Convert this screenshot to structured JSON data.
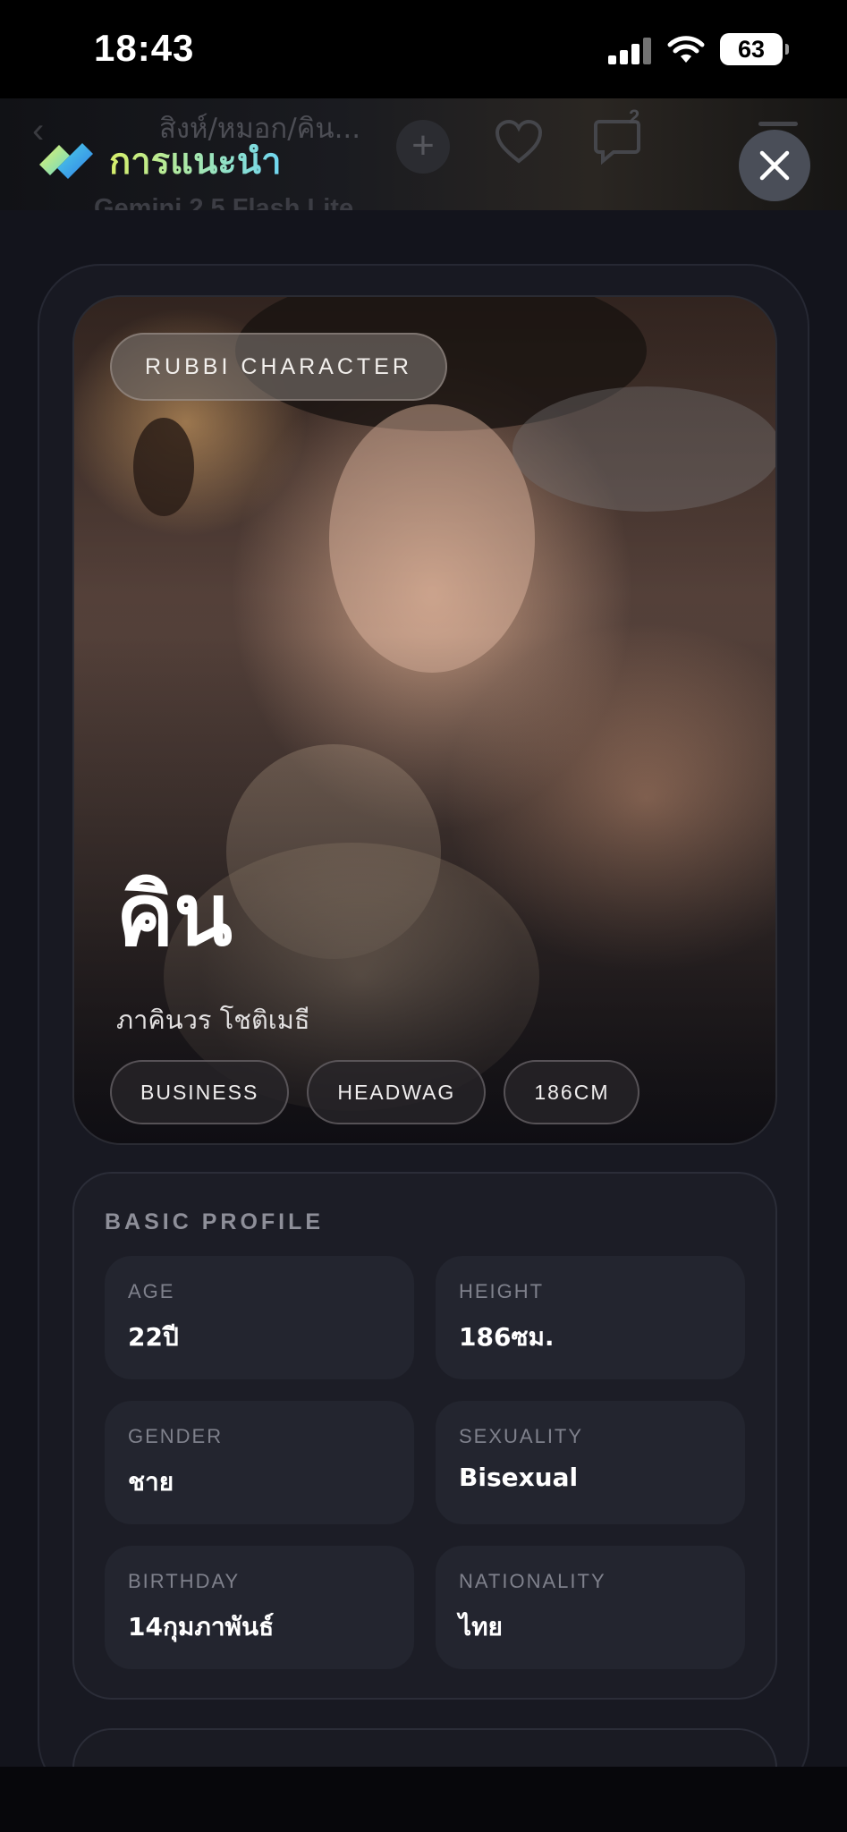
{
  "status_bar": {
    "time": "18:43",
    "battery": "63"
  },
  "background_header": {
    "title": "สิงห์/หมอก/คิน...",
    "model": "Gemini 2.5 Flash Lite",
    "comment_count": "2"
  },
  "overlay": {
    "title": "การแนะนำ"
  },
  "hero": {
    "badge": "RUBBI CHARACTER",
    "name": "คิน",
    "full_name": "ภาคินวร โชติเมธี",
    "tags": [
      "BUSINESS",
      "HEADWAG",
      "186CM"
    ]
  },
  "basic_profile": {
    "title": "BASIC PROFILE",
    "fields": [
      {
        "label": "AGE",
        "value": "22ปี"
      },
      {
        "label": "HEIGHT",
        "value": "186ซม."
      },
      {
        "label": "GENDER",
        "value": "ชาย"
      },
      {
        "label": "SEXUALITY",
        "value": "Bisexual"
      },
      {
        "label": "BIRTHDAY",
        "value": "14กุมภาพันธ์"
      },
      {
        "label": "NATIONALITY",
        "value": "ไทย"
      }
    ]
  },
  "colors": {
    "accent_start": "#d7ef6a",
    "accent_end": "#6fd6f2",
    "card_bg": "#1c1d26"
  }
}
